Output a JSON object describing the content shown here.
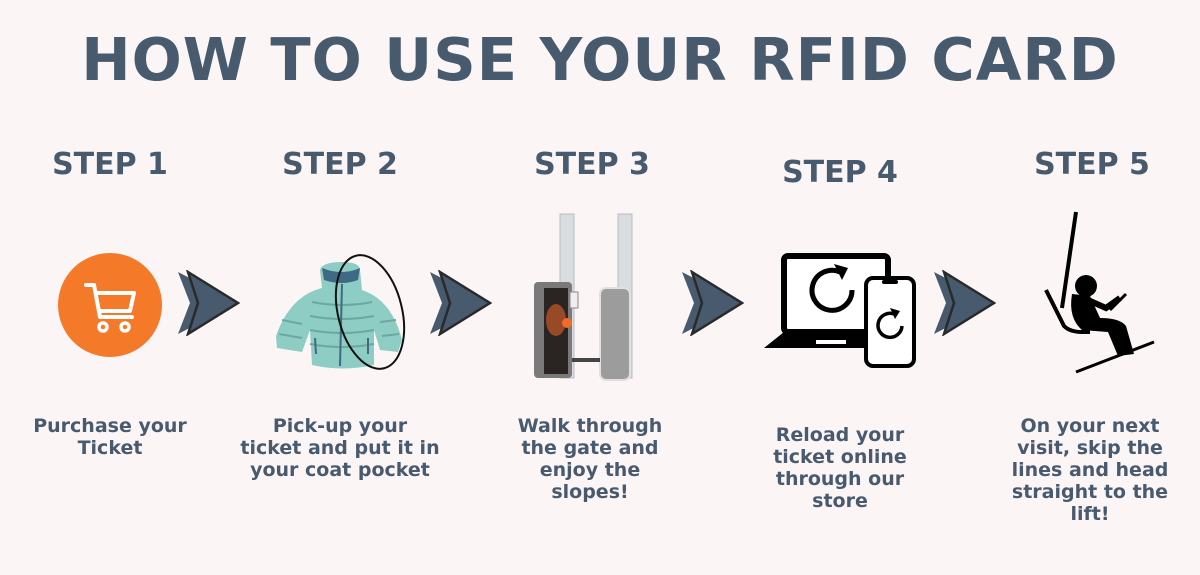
{
  "title": "HOW TO USE YOUR RFID CARD",
  "colors": {
    "text": "#475a6e",
    "background": "#fcf5f5",
    "accent": "#f47a2a",
    "jacket": "#8ecdc3"
  },
  "steps": [
    {
      "label": "STEP 1",
      "icon": "shopping-cart-icon",
      "description": "Purchase your Ticket"
    },
    {
      "label": "STEP 2",
      "icon": "jacket-icon",
      "description": "Pick-up your ticket and put it in your coat pocket"
    },
    {
      "label": "STEP 3",
      "icon": "rfid-gate-icon",
      "description": "Walk through the gate and enjoy the slopes!"
    },
    {
      "label": "STEP 4",
      "icon": "reload-devices-icon",
      "description": "Reload your ticket online through our store"
    },
    {
      "label": "STEP 5",
      "icon": "chairlift-skier-icon",
      "description": "On your next visit, skip the lines and head straight to the lift!"
    }
  ]
}
